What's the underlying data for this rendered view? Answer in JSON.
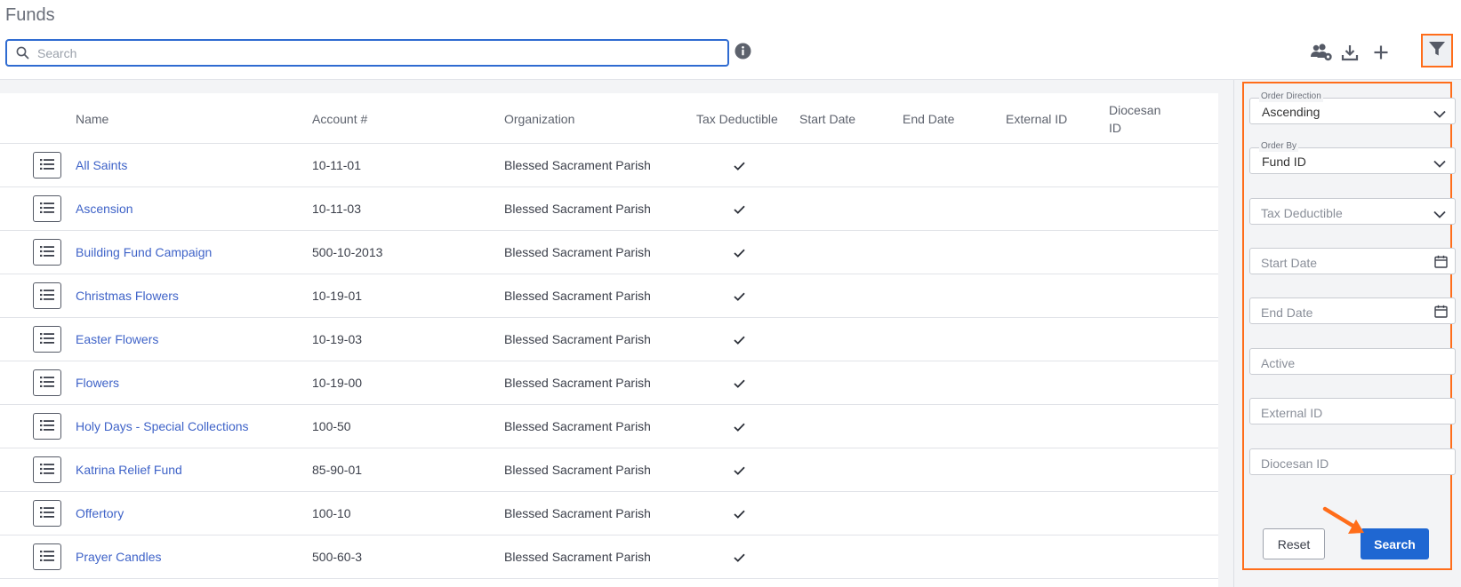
{
  "page": {
    "title": "Funds"
  },
  "search": {
    "placeholder": "Search"
  },
  "table": {
    "columns": [
      "Name",
      "Account #",
      "Organization",
      "Tax Deductible",
      "Start Date",
      "End Date",
      "External ID",
      "Diocesan ID"
    ],
    "rows": [
      {
        "name": "All Saints",
        "account": "10-11-01",
        "organization": "Blessed Sacrament Parish",
        "tax_deductible": true
      },
      {
        "name": "Ascension",
        "account": "10-11-03",
        "organization": "Blessed Sacrament Parish",
        "tax_deductible": true
      },
      {
        "name": "Building Fund Campaign",
        "account": "500-10-2013",
        "organization": "Blessed Sacrament Parish",
        "tax_deductible": true
      },
      {
        "name": "Christmas Flowers",
        "account": "10-19-01",
        "organization": "Blessed Sacrament Parish",
        "tax_deductible": true
      },
      {
        "name": "Easter Flowers",
        "account": "10-19-03",
        "organization": "Blessed Sacrament Parish",
        "tax_deductible": true
      },
      {
        "name": "Flowers",
        "account": "10-19-00",
        "organization": "Blessed Sacrament Parish",
        "tax_deductible": true
      },
      {
        "name": "Holy Days - Special Collections",
        "account": "100-50",
        "organization": "Blessed Sacrament Parish",
        "tax_deductible": true
      },
      {
        "name": "Katrina Relief Fund",
        "account": "85-90-01",
        "organization": "Blessed Sacrament Parish",
        "tax_deductible": true
      },
      {
        "name": "Offertory",
        "account": "100-10",
        "organization": "Blessed Sacrament Parish",
        "tax_deductible": true
      },
      {
        "name": "Prayer Candles",
        "account": "500-60-3",
        "organization": "Blessed Sacrament Parish",
        "tax_deductible": true
      }
    ]
  },
  "filters": {
    "order_direction": {
      "label": "Order Direction",
      "value": "Ascending"
    },
    "order_by": {
      "label": "Order By",
      "value": "Fund ID"
    },
    "tax_deductible": {
      "placeholder": "Tax Deductible"
    },
    "start_date": {
      "placeholder": "Start Date"
    },
    "end_date": {
      "placeholder": "End Date"
    },
    "active": {
      "placeholder": "Active"
    },
    "external_id": {
      "placeholder": "External ID"
    },
    "diocesan_id": {
      "placeholder": "Diocesan ID"
    },
    "reset_label": "Reset",
    "search_label": "Search"
  },
  "icons": {
    "toolbar": [
      "manage-users-icon",
      "download-icon",
      "plus-icon",
      "filter-icon"
    ],
    "row_action": "list-icon",
    "tax_deductible_true": "check-icon"
  },
  "colors": {
    "primary": "#1f67d2",
    "link": "#3f63c8",
    "highlight": "#ff6d1a"
  }
}
